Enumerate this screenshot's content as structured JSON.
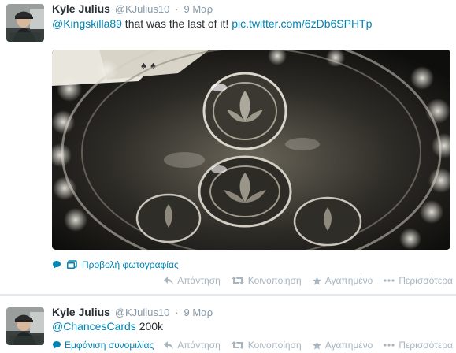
{
  "tweets": [
    {
      "fullname": "Kyle Julius",
      "username": "@KJulius10",
      "separator": "·",
      "time": "9 Μαρ",
      "mention": "@Kingskilla89",
      "text": " that was the last of it! ",
      "media_link": "pic.twitter.com/6zDb6SPHTp",
      "expand_label": "Προβολή φωτογραφίας"
    },
    {
      "fullname": "Kyle Julius",
      "username": "@KJulius10",
      "separator": "·",
      "time": "9 Μαρ",
      "mention": "@ChancesCards",
      "text": " 200k",
      "expand_label": "Εμφάνιση συνομιλίας"
    }
  ],
  "actions": {
    "reply": "Απάντηση",
    "retweet": "Κοινοποίηση",
    "favorite": "Αγαπημένο",
    "more": "Περισσότερα"
  },
  "colors": {
    "link": "#0084b4",
    "muted": "#8899a6",
    "action": "#a9b6c0"
  },
  "icons": {
    "photo": "photo-icon",
    "conversation": "conversation-icon",
    "reply": "reply-icon",
    "retweet": "retweet-icon",
    "favorite": "star-icon",
    "more": "more-dots-icon"
  }
}
